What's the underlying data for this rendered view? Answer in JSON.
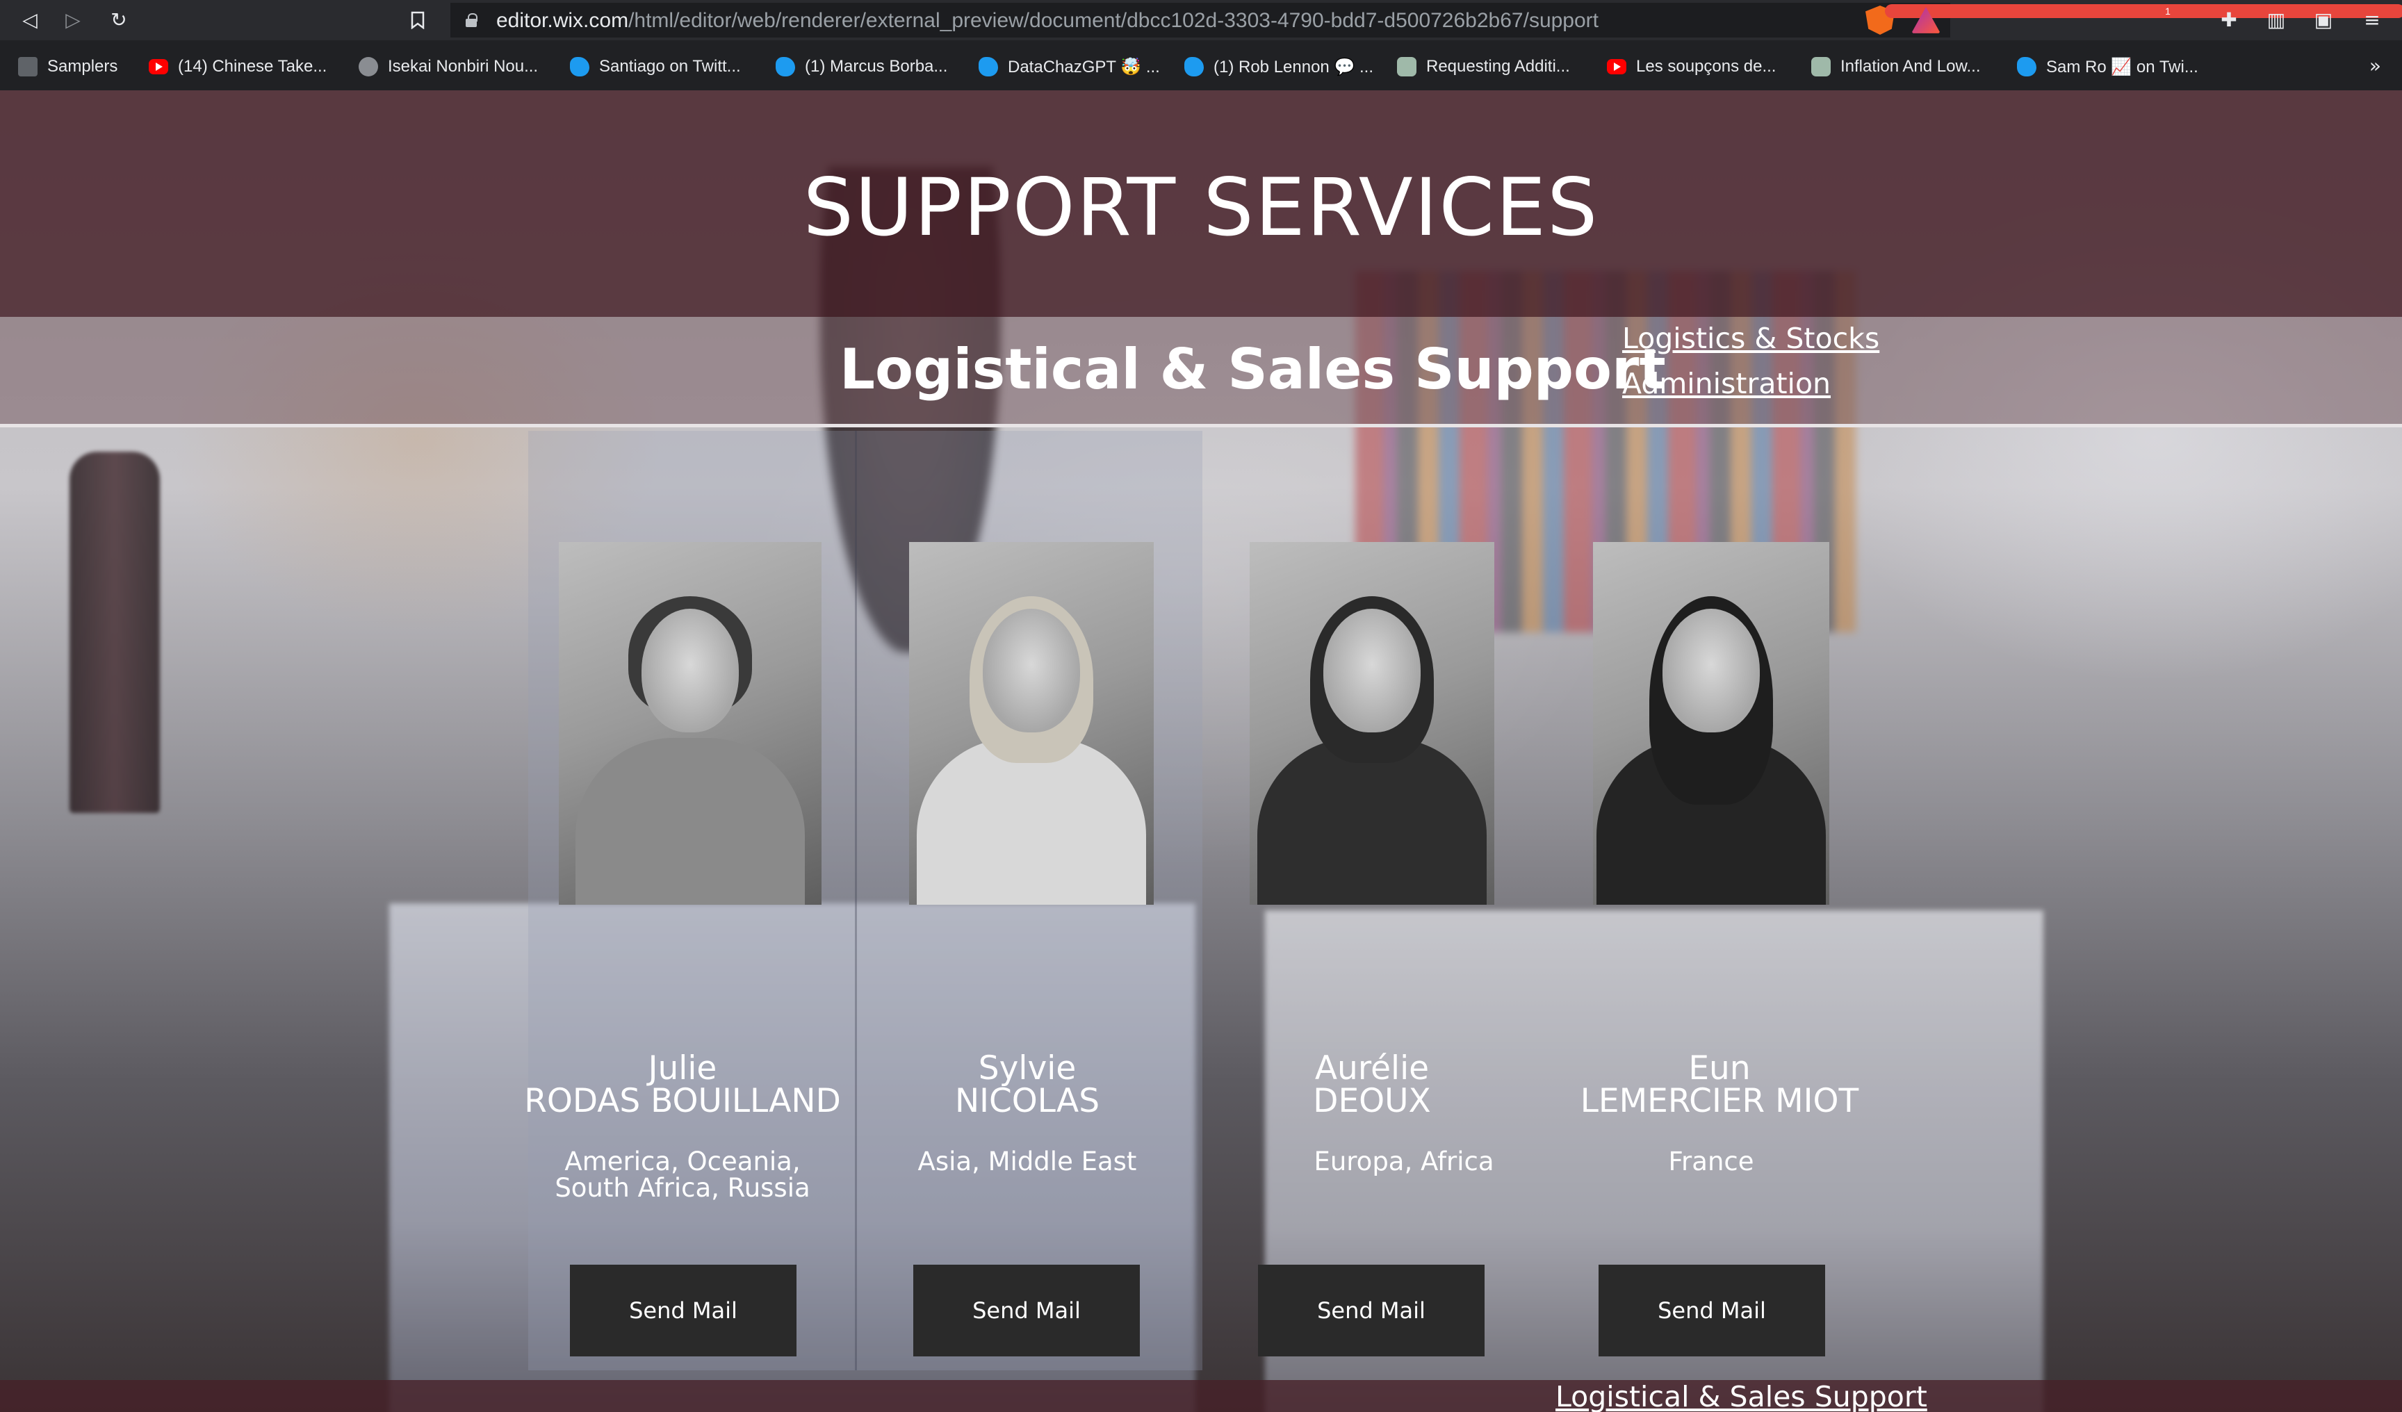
{
  "browser": {
    "url_host": "editor.wix.com",
    "url_path": "/html/editor/web/renderer/external_preview/document/dbcc102d-3303-4790-bdd7-d500726b2b67/support",
    "brave_badge_count": "1",
    "rewards_badge_count": "1",
    "bookmarks": [
      {
        "label": "Samplers",
        "icon": "crown-icon"
      },
      {
        "label": "(14) Chinese Take...",
        "icon": "youtube-icon"
      },
      {
        "label": "Isekai Nonbiri Nou...",
        "icon": "globe-icon"
      },
      {
        "label": "Santiago on Twitt...",
        "icon": "twitter-icon"
      },
      {
        "label": "(1) Marcus Borba...",
        "icon": "twitter-icon"
      },
      {
        "label": "DataChazGPT 🤯 ...",
        "icon": "twitter-icon"
      },
      {
        "label": "(1) Rob Lennon 💬 ...",
        "icon": "twitter-icon"
      },
      {
        "label": "Requesting Additi...",
        "icon": "openai-icon"
      },
      {
        "label": "Les soupçons de...",
        "icon": "youtube-icon"
      },
      {
        "label": "Inflation And Low...",
        "icon": "openai-icon"
      },
      {
        "label": "Sam Ro 📈 on Twi...",
        "icon": "twitter-icon"
      }
    ],
    "more_bookmarks": "»"
  },
  "page": {
    "title": "SUPPORT SERVICES",
    "subtitle": "Logistical & Sales Support",
    "side_links": [
      "Logistics & Stocks",
      "Administration"
    ],
    "bottom_link": "Logistical & Sales Support"
  },
  "members": [
    {
      "first": "Julie",
      "last": "RODAS BOUILLAND",
      "region": "America, Oceania, South Africa, Russia",
      "button": "Send Mail"
    },
    {
      "first": "Sylvie",
      "last": "NICOLAS",
      "region": "Asia, Middle East",
      "button": "Send Mail"
    },
    {
      "first": "Aurélie",
      "last": "DEOUX",
      "region": "Europa, Africa",
      "button": "Send Mail"
    },
    {
      "first": "Eun",
      "last": "LEMERCIER MIOT",
      "region": "France",
      "button": "Send Mail"
    }
  ]
}
